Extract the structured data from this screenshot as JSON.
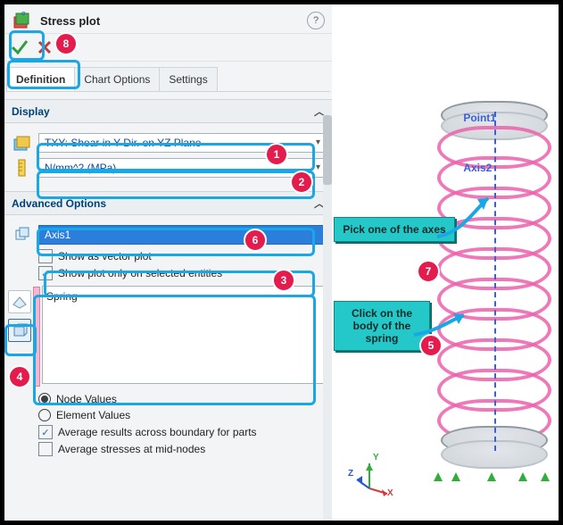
{
  "header": {
    "title": "Stress plot"
  },
  "tabs": {
    "definition": "Definition",
    "chartOptions": "Chart Options",
    "settings": "Settings"
  },
  "display": {
    "heading": "Display",
    "stress": "TXY: Shear in Y Dir. on YZ Plane",
    "units": "N/mm^2 (MPa)"
  },
  "advanced": {
    "heading": "Advanced Options",
    "axisItem": "Axis1",
    "showVector": "Show as vector plot",
    "showOnSel": "Show plot only on selected entities",
    "listItem": "Spring",
    "nodeValues": "Node Values",
    "elementValues": "Element Values",
    "avgBoundary": "Average results across boundary for parts",
    "avgMid": "Average stresses at mid-nodes"
  },
  "callouts": {
    "axes": "Pick one of the axes",
    "body": "Click on the body of the spring"
  },
  "sceneLabels": {
    "point": "Point1",
    "axis2": "Axis2"
  },
  "triad": {
    "x": "X",
    "y": "Y",
    "z": "Z"
  },
  "badges": {
    "b1": "1",
    "b2": "2",
    "b3": "3",
    "b4": "4",
    "b5": "5",
    "b6": "6",
    "b7": "7",
    "b8": "8"
  }
}
